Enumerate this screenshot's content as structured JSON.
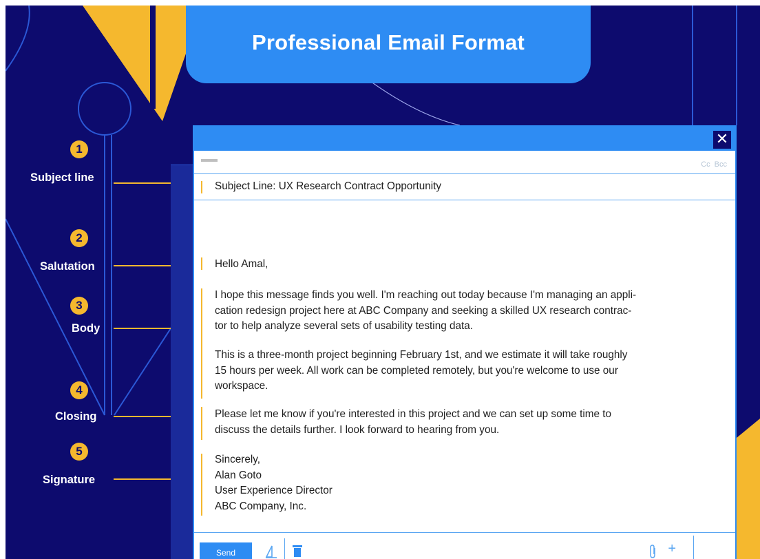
{
  "header": {
    "title": "Professional Email Format"
  },
  "sections": [
    {
      "number": "1",
      "label": "Subject line"
    },
    {
      "number": "2",
      "label": "Salutation"
    },
    {
      "number": "3",
      "label": "Body"
    },
    {
      "number": "4",
      "label": "Closing"
    },
    {
      "number": "5",
      "label": "Signature"
    }
  ],
  "email": {
    "close_label": "✕",
    "cc_label": "Cc",
    "bcc_label": "Bcc",
    "subject": "Subject Line: UX Research Contract Opportunity",
    "salutation": "Hello Amal,",
    "body_paragraph_1": [
      "I hope this message finds you well. I'm reaching out today because I'm managing an appli-",
      "cation redesign project here at ABC Company and seeking a skilled UX research contrac-",
      "tor to help analyze several sets of usability testing data."
    ],
    "body_paragraph_2": [
      "This is a three-month project beginning February 1st, and we estimate it will take roughly",
      "15 hours per week. All work can be completed remotely, but you're welcome to use our",
      "workspace."
    ],
    "closing": [
      "Please let me know if you're interested in this project and we can set up some time to",
      "discuss the details further. I look forward to hearing from you."
    ],
    "signature": [
      "Sincerely,",
      "Alan Goto",
      "User Experience Director",
      "ABC Company, Inc."
    ],
    "send_label": "Send"
  },
  "colors": {
    "background": "#0d0b6e",
    "accent_blue": "#2e8cf3",
    "accent_yellow": "#f5b82e"
  },
  "icons": [
    "close-icon",
    "format-text-icon",
    "trash-icon",
    "paperclip-icon",
    "plus-icon"
  ]
}
